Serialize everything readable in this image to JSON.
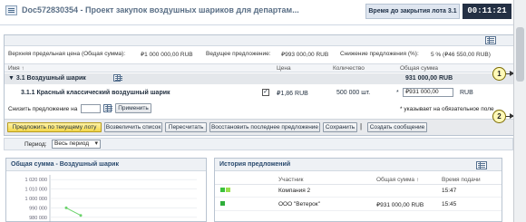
{
  "header": {
    "title": "Doc572830354 - Проект закупок воздушных шариков для департам...",
    "timer_label": "Время до закрытия лота 3.1",
    "timer_value": "00:11:21"
  },
  "summary": {
    "upper_limit_label": "Верхняя предельная цена (Общая сумма):",
    "upper_limit_value": "₽1 000 000,00 RUB",
    "leading_label": "Ведущее предложение:",
    "leading_value": "₽993 000,00 RUB",
    "reduction_label": "Снижение предложения (%):",
    "reduction_value": "5 % (₽46 550,00 RUB)"
  },
  "columns": {
    "name": "Имя ↑",
    "price": "Цена",
    "quantity": "Количество",
    "total": "Общая сумма"
  },
  "group_row": {
    "label": "▼ 3.1  Воздушный шарик",
    "total_value": "931 000,00 RUB"
  },
  "item_row": {
    "label": "3.1.1   Красный классический воздушный шарик",
    "checked_mark": "✓",
    "price": "₽1,86 RUB",
    "quantity": "500 000 шт.",
    "required_marker": "*",
    "total_input": "₽931 000,00",
    "currency": "RUB"
  },
  "reduce": {
    "label": "Снизить предложение на",
    "input_value": "",
    "apply_button": "Применить",
    "required_note": "* указывает на обязательное поле"
  },
  "toolbar": {
    "buttons": [
      "Предложить по текущему лоту",
      "Возвеличить список",
      "Пересчитать",
      "Восстановить последнее предложение",
      "Сохранить",
      "Создать сообщение"
    ],
    "separator": "|"
  },
  "period": {
    "label": "Период:",
    "selected": "Весь период"
  },
  "chart": {
    "title": "Общая сумма - Воздушный шарик"
  },
  "chart_data": {
    "type": "line",
    "title": "Общая сумма - Воздушный шарик",
    "xlabel": "",
    "ylabel": "",
    "yticks": [
      "1 020 000",
      "1 010 000",
      "1 000 000",
      "990 000",
      "980 000"
    ],
    "ylim": [
      975000,
      1025000
    ],
    "series": [
      {
        "values": [
          990000,
          982000
        ]
      }
    ]
  },
  "history": {
    "title": "История предложений",
    "columns": [
      "Участник",
      "Общая сумма ↑",
      "Время подачи"
    ],
    "rows": [
      {
        "participant": "Компания 2",
        "total": "",
        "time": "15:47",
        "color1": "#3cc13c",
        "color2": "#9adf4f"
      },
      {
        "participant": "ООО \"Ветерок\"",
        "total": "₽931 000,00 RUB",
        "time": "15:45",
        "color1": "#2fae3a",
        "color2": ""
      }
    ]
  },
  "callouts": [
    "1",
    "2"
  ],
  "colors": {
    "accent": "#2a4a6e",
    "primary_button": "#f2d64a",
    "timer_bg": "#243044",
    "series_line": "#6bd36b"
  }
}
